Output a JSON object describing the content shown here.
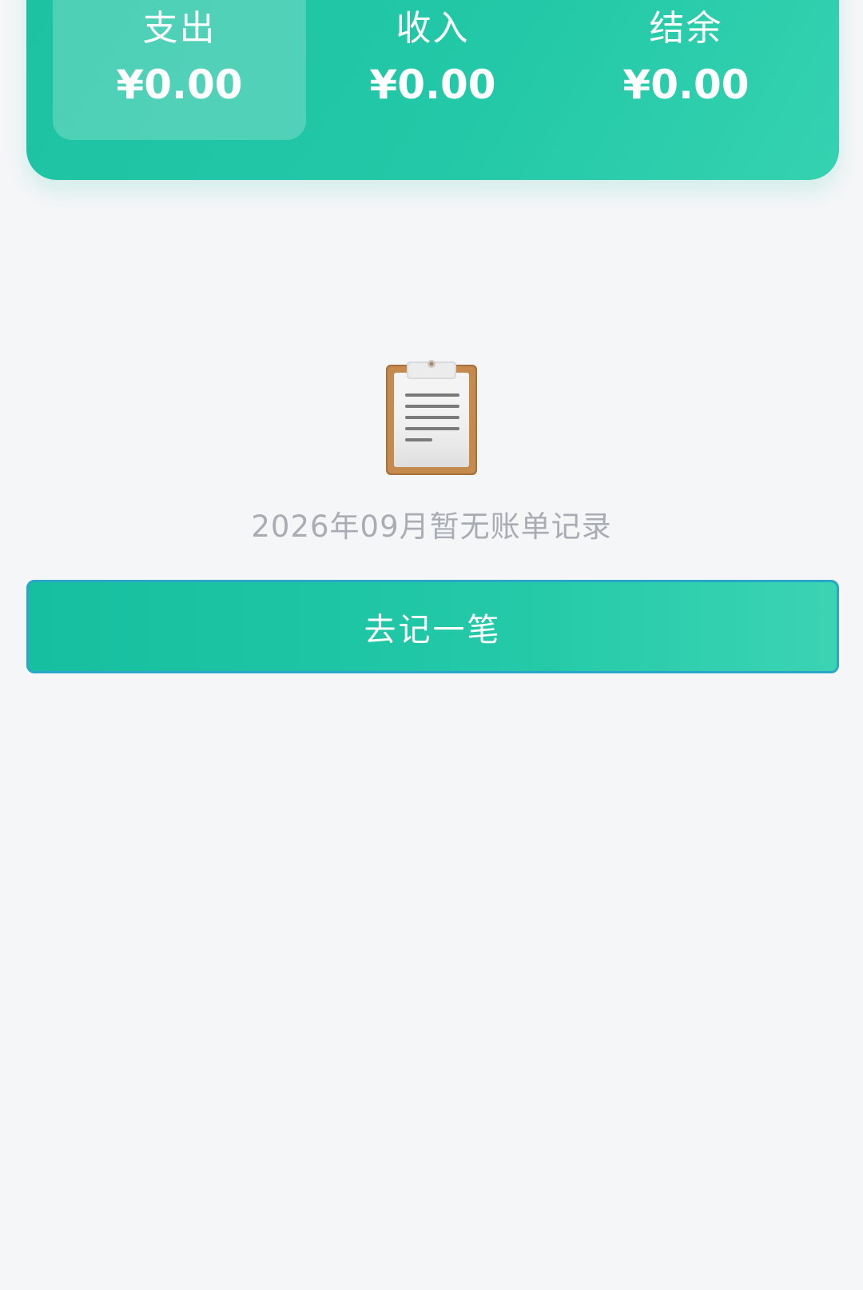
{
  "summary": {
    "items": [
      {
        "label": "支出",
        "value": "¥0.00"
      },
      {
        "label": "收入",
        "value": "¥0.00"
      },
      {
        "label": "结余",
        "value": "¥0.00"
      }
    ],
    "active_index": 0,
    "colors": {
      "accent": "#22c8a7",
      "accent_light": "#35d2b0"
    }
  },
  "empty_state": {
    "icon": "clipboard-icon",
    "message": "2026年09月暂无账单记录"
  },
  "actions": {
    "add_record_label": "去记一笔"
  }
}
